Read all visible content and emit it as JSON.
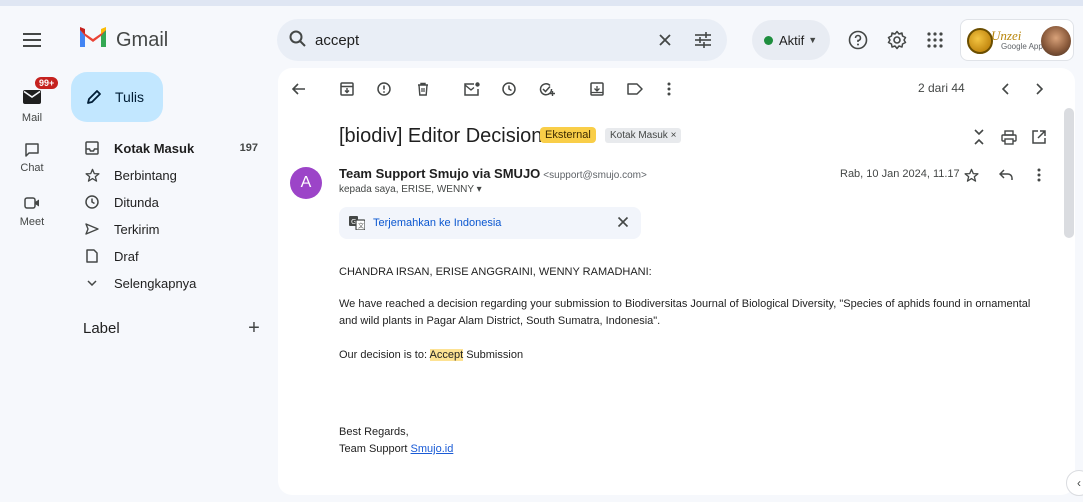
{
  "app": {
    "name": "Gmail"
  },
  "search": {
    "value": "accept"
  },
  "status": {
    "label": "Aktif"
  },
  "account": {
    "brand_text": "Unzei",
    "brand_sub": "Google Apps"
  },
  "rail": [
    {
      "label": "Mail",
      "badge": "99+"
    },
    {
      "label": "Chat"
    },
    {
      "label": "Meet"
    }
  ],
  "compose": {
    "label": "Tulis"
  },
  "nav": [
    {
      "label": "Kotak Masuk",
      "count": "197",
      "icon": "inbox-icon"
    },
    {
      "label": "Berbintang",
      "icon": "star-icon"
    },
    {
      "label": "Ditunda",
      "icon": "clock-icon"
    },
    {
      "label": "Terkirim",
      "icon": "send-icon"
    },
    {
      "label": "Draf",
      "icon": "draft-icon"
    },
    {
      "label": "Selengkapnya",
      "icon": "chevron-down-icon"
    }
  ],
  "labels": {
    "title": "Label"
  },
  "toolbar": {
    "pager": "2 dari 44"
  },
  "email": {
    "subject": "[biodiv] Editor Decision",
    "chip_external": "Eksternal",
    "chip_inbox": "Kotak Masuk ×",
    "avatar_letter": "A",
    "sender_name": "Team Support Smujo via SMUJO",
    "sender_email": "<support@smujo.com>",
    "recipients": "kepada saya, ERISE, WENNY ▾",
    "date": "Rab, 10 Jan 2024, 11.17",
    "translate": "Terjemahkan ke Indonesia",
    "greeting": "CHANDRA IRSAN, ERISE ANGGRAINI, WENNY RAMADHANI:",
    "para1": "We have reached a decision regarding your submission to Biodiversitas Journal of Biological Diversity, \"Species of aphids found in ornamental and wild plants in Pagar Alam District, South Sumatra, Indonesia\".",
    "decision_prefix": "Our decision is to: ",
    "decision_highlight": "Accept",
    "decision_suffix": " Submission",
    "regards": "Best Regards,",
    "signature_prefix": "Team Support ",
    "signature_link": "Smujo.id"
  },
  "colors": {
    "accent": "#c2e7ff",
    "highlight": "#fde293",
    "external_chip": "#f9ce48",
    "avatar": "#9c44c8",
    "badge": "#c5221f"
  }
}
